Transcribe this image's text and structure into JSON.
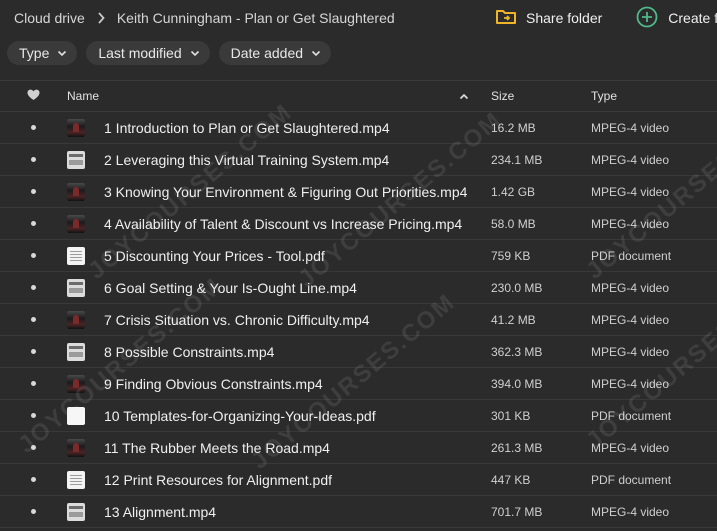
{
  "breadcrumb": {
    "root": "Cloud drive",
    "current": "Keith Cunningham - Plan or Get Slaughtered"
  },
  "actions": {
    "share_folder": "Share folder",
    "create_folder": "Create fo"
  },
  "filters": {
    "type": "Type",
    "last_modified": "Last modified",
    "date_added": "Date added"
  },
  "columns": {
    "name": "Name",
    "size": "Size",
    "type": "Type"
  },
  "watermark": "JOYCOURSES.COM",
  "files": [
    {
      "name": "1 Introduction to Plan or Get Slaughtered.mp4",
      "size": "16.2 MB",
      "type": "MPEG-4 video",
      "thumb": "video"
    },
    {
      "name": "2 Leveraging this Virtual Training System.mp4",
      "size": "234.1 MB",
      "type": "MPEG-4 video",
      "thumb": "slide"
    },
    {
      "name": "3 Knowing Your Environment & Figuring Out Priorities.mp4",
      "size": "1.42 GB",
      "type": "MPEG-4 video",
      "thumb": "video"
    },
    {
      "name": "4 Availability of Talent & Discount vs Increase Pricing.mp4",
      "size": "58.0 MB",
      "type": "MPEG-4 video",
      "thumb": "video"
    },
    {
      "name": "5 Discounting Your Prices - Tool.pdf",
      "size": "759 KB",
      "type": "PDF document",
      "thumb": "doc"
    },
    {
      "name": "6 Goal Setting & Your Is-Ought Line.mp4",
      "size": "230.0 MB",
      "type": "MPEG-4 video",
      "thumb": "slide"
    },
    {
      "name": "7 Crisis Situation vs. Chronic Difficulty.mp4",
      "size": "41.2 MB",
      "type": "MPEG-4 video",
      "thumb": "video"
    },
    {
      "name": "8 Possible Constraints.mp4",
      "size": "362.3 MB",
      "type": "MPEG-4 video",
      "thumb": "slide"
    },
    {
      "name": "9 Finding Obvious Constraints.mp4",
      "size": "394.0 MB",
      "type": "MPEG-4 video",
      "thumb": "video"
    },
    {
      "name": "10 Templates-for-Organizing-Your-Ideas.pdf",
      "size": "301 KB",
      "type": "PDF document",
      "thumb": "blank"
    },
    {
      "name": "11 The Rubber Meets the Road.mp4",
      "size": "261.3 MB",
      "type": "MPEG-4 video",
      "thumb": "video"
    },
    {
      "name": "12 Print Resources for Alignment.pdf",
      "size": "447 KB",
      "type": "PDF document",
      "thumb": "doc"
    },
    {
      "name": "13 Alignment.mp4",
      "size": "701.7 MB",
      "type": "MPEG-4 video",
      "thumb": "slide"
    }
  ],
  "colors": {
    "background": "#2b2b2b",
    "chip": "#3a3a3a",
    "share_icon": "#f0b429",
    "create_icon": "#4fb98a"
  }
}
